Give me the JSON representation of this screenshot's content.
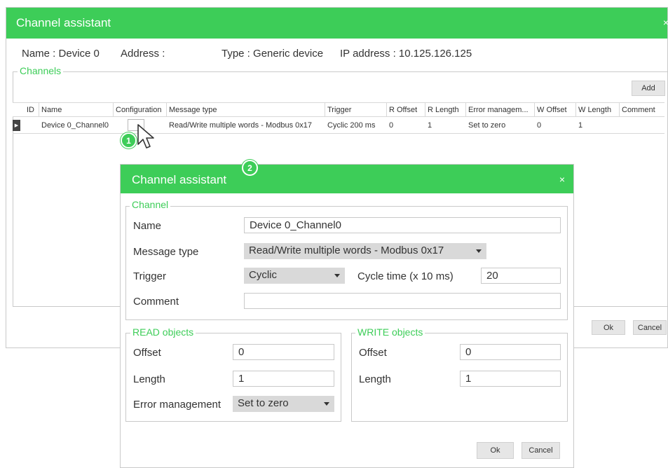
{
  "main_window": {
    "title": "Channel assistant",
    "close_label": "×",
    "name": "Name : Device 0",
    "address": "Address :",
    "type": "Type : Generic device",
    "ip": "IP address : 10.125.126.125",
    "channels_legend": "Channels",
    "add_label": "Add",
    "ok_label": "Ok",
    "cancel_label": "Cancel"
  },
  "grid": {
    "columns": [
      "ID",
      "Name",
      "Configuration",
      "Message type",
      "Trigger",
      "R Offset",
      "R Length",
      "Error managem...",
      "W Offset",
      "W Length",
      "Comment"
    ],
    "rows": [
      {
        "id": "",
        "name": "Device 0_Channel0",
        "configuration": "",
        "message_type": "Read/Write multiple words - Modbus 0x17",
        "trigger": "Cyclic 200 ms",
        "r_offset": "0",
        "r_length": "1",
        "error_management": "Set to zero",
        "w_offset": "0",
        "w_length": "1",
        "comment": ""
      }
    ]
  },
  "callouts": [
    "1",
    "2"
  ],
  "dialog": {
    "title": "Channel assistant",
    "close_label": "×",
    "channel_legend": "Channel",
    "name_label": "Name",
    "name_value": "Device 0_Channel0",
    "message_type_label": "Message type",
    "message_type_value": "Read/Write multiple words - Modbus 0x17",
    "trigger_label": "Trigger",
    "trigger_value": "Cyclic",
    "cycle_time_label": "Cycle time (x 10 ms)",
    "cycle_time_value": "20",
    "comment_label": "Comment",
    "comment_value": "",
    "read_legend": "READ objects",
    "read_offset_label": "Offset",
    "read_offset_value": "0",
    "read_length_label": "Length",
    "read_length_value": "1",
    "error_management_label": "Error management",
    "error_management_value": "Set to zero",
    "write_legend": "WRITE objects",
    "write_offset_label": "Offset",
    "write_offset_value": "0",
    "write_length_label": "Length",
    "write_length_value": "1",
    "ok_label": "Ok",
    "cancel_label": "Cancel"
  },
  "icons": {
    "close": "close-icon",
    "row_marker": "row-selector-icon",
    "dropdown": "chevron-down-icon",
    "cursor": "mouse-pointer-icon"
  },
  "colors": {
    "accent": "#3dcd58",
    "button_bg": "#e6e6e6",
    "select_bg": "#d9d9d9"
  }
}
